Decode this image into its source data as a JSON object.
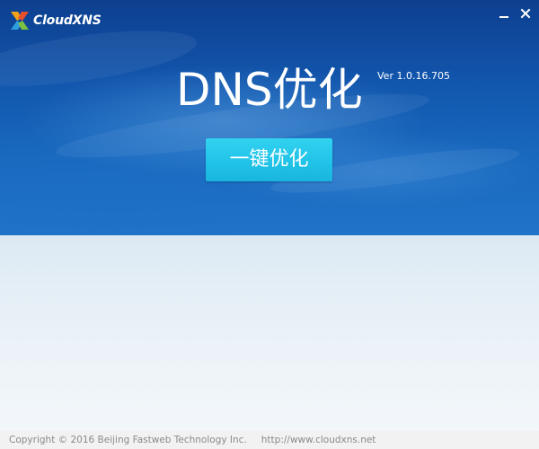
{
  "app": {
    "logo_text": "CloudXNS",
    "title": "DNS优化",
    "version": "Ver 1.0.16.705"
  },
  "window_controls": {
    "minimize_icon": "minimize-icon",
    "close_icon": "close-icon"
  },
  "actions": {
    "optimize_label": "一键优化"
  },
  "footer": {
    "copyright": "Copyright © 2016 Beijing Fastweb Technology Inc.",
    "url": "http://www.cloudxns.net"
  },
  "colors": {
    "header_dark": "#0d3f8f",
    "header_light": "#1f73c8",
    "button": "#21c3e8",
    "content_bg": "#e9f1f7",
    "footer_bg": "#f2f2f2",
    "footer_text": "#8a8a8a"
  }
}
